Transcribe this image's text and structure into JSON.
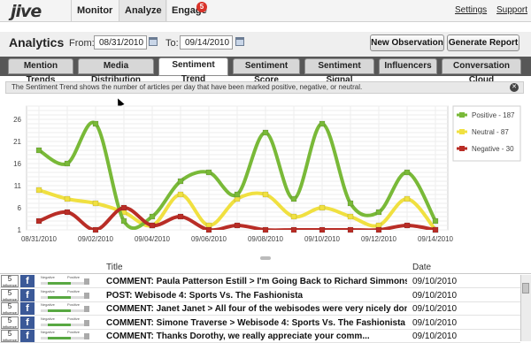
{
  "header": {
    "logo": "jive",
    "nav": [
      "Monitor",
      "Analyze",
      "Engage"
    ],
    "engage_badge": "5",
    "links": [
      "Settings",
      "Support"
    ]
  },
  "subheader": {
    "title": "Analytics",
    "from_label": "From:",
    "from_date": "08/31/2010",
    "to_label": "To:",
    "to_date": "09/14/2010",
    "buttons": [
      "New Observation",
      "Generate Report"
    ]
  },
  "tabs": [
    "Mention Trends",
    "Media Distribution",
    "Sentiment Trend",
    "Sentiment Score",
    "Sentiment Signal",
    "Influencers",
    "Conversation Cloud"
  ],
  "active_tab": "Sentiment Trend",
  "info_text": "The Sentiment Trend shows the number of articles per day that have been marked positive, negative, or neutral.",
  "chart_data": {
    "type": "line",
    "x": [
      "08/31/2010",
      "09/01/2010",
      "09/02/2010",
      "09/03/2010",
      "09/04/2010",
      "09/05/2010",
      "09/06/2010",
      "09/07/2010",
      "09/08/2010",
      "09/09/2010",
      "09/10/2010",
      "09/11/2010",
      "09/12/2010",
      "09/13/2010",
      "09/14/2010"
    ],
    "x_tick_labels": [
      "08/31/2010",
      "09/02/2010",
      "09/04/2010",
      "09/06/2010",
      "09/08/2010",
      "09/10/2010",
      "09/12/2010",
      "09/14/2010"
    ],
    "y_ticks": [
      1,
      6,
      11,
      16,
      21,
      26
    ],
    "ylim": [
      1,
      29
    ],
    "series": [
      {
        "name": "Positive - 187",
        "color": "#79b938",
        "values": [
          19,
          16,
          25,
          3,
          4,
          12,
          14,
          9,
          23,
          8,
          25,
          7,
          5,
          14,
          3
        ]
      },
      {
        "name": "Neutral - 87",
        "color": "#f0e040",
        "values": [
          10,
          8,
          7,
          5,
          2,
          9,
          2,
          8,
          9,
          4,
          6,
          4,
          2,
          8,
          1
        ]
      },
      {
        "name": "Negative - 30",
        "color": "#b92d26",
        "values": [
          3,
          5,
          1,
          6,
          2,
          4,
          1,
          2,
          1,
          1,
          1,
          1,
          1,
          2,
          1
        ]
      }
    ],
    "grid": true,
    "legend": "right"
  },
  "table": {
    "headers": [
      "Title",
      "Date"
    ],
    "rows": [
      {
        "influence": "5",
        "mini_neg": "Negative",
        "mini_pos": "Positive",
        "text": "COMMENT: Paula Patterson Estill > I'm Going Back to Richard Simmons - Over...",
        "date": "09/10/2010"
      },
      {
        "influence": "5",
        "mini_neg": "Negative",
        "mini_pos": "Positive",
        "text": "POST: Webisode 4: Sports Vs. The Fashionista",
        "date": "09/10/2010"
      },
      {
        "influence": "5",
        "mini_neg": "Negative",
        "mini_pos": "Positive",
        "text": "COMMENT: Janet Janet > All four of the webisodes were very nicely done. I enj...",
        "date": "09/10/2010"
      },
      {
        "influence": "5",
        "mini_neg": "Negative",
        "mini_pos": "Positive",
        "text": "COMMENT: Simone Traverse > Webisode 4: Sports Vs. The Fashionista",
        "date": "09/10/2010"
      },
      {
        "influence": "5",
        "mini_neg": "Negative",
        "mini_pos": "Positive",
        "text": "COMMENT:  Thanks Dorothy, we really appreciate your comm...",
        "date": "09/10/2010"
      }
    ],
    "influence_label": "influence",
    "fb_glyph": "f"
  }
}
